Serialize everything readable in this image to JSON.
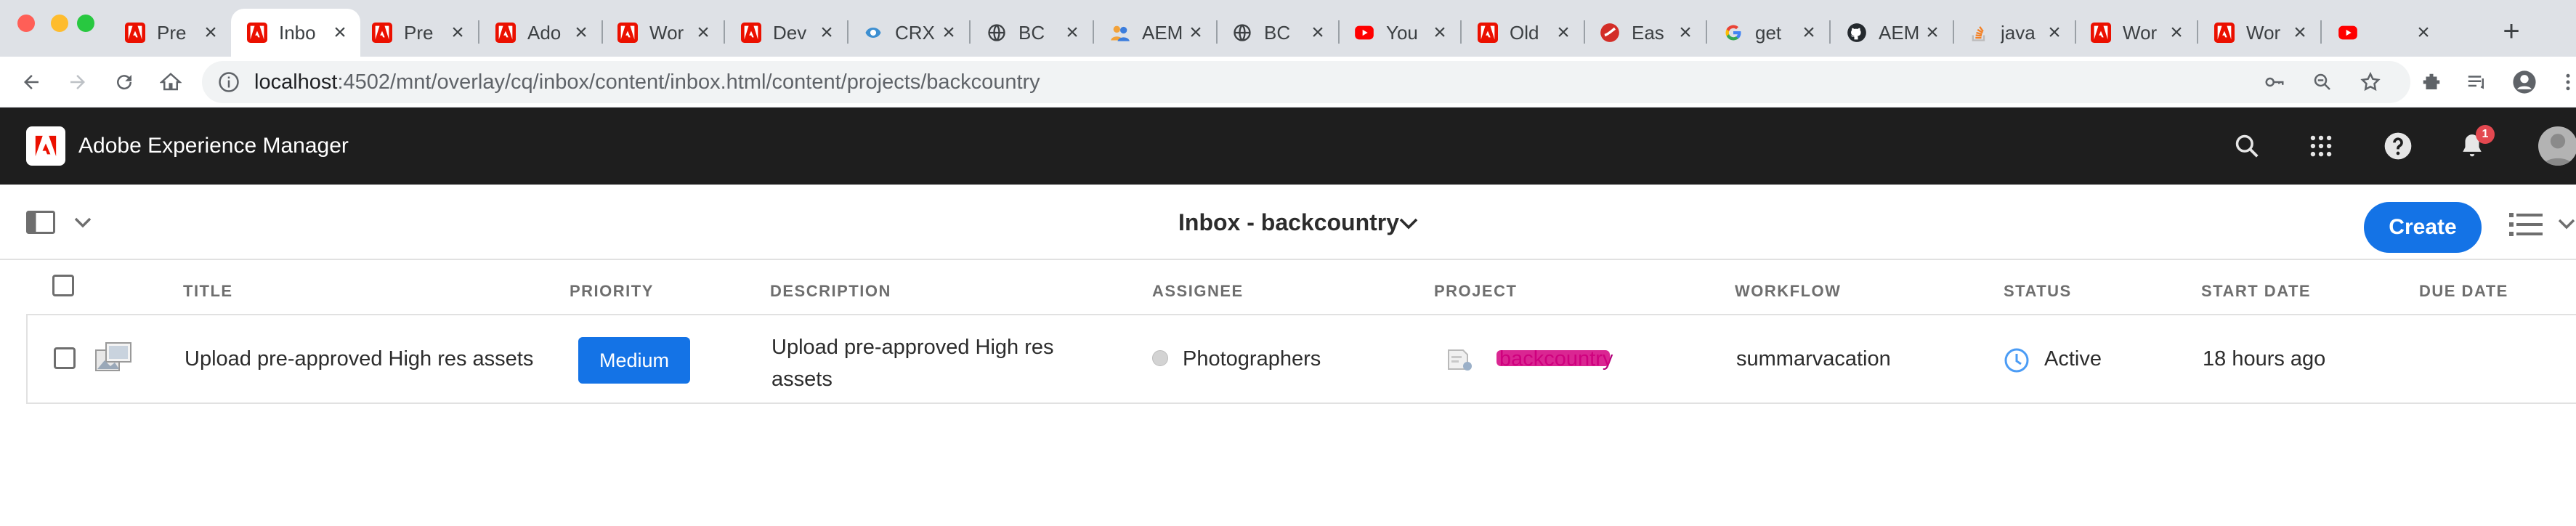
{
  "browser": {
    "tabs": [
      {
        "label": "Pre",
        "icon": "adobe-icon",
        "active": false
      },
      {
        "label": "Inbo",
        "icon": "adobe-icon",
        "active": true
      },
      {
        "label": "Pre",
        "icon": "adobe-icon",
        "active": false
      },
      {
        "label": "Ado",
        "icon": "adobe-icon",
        "active": false
      },
      {
        "label": "Wor",
        "icon": "adobe-icon",
        "active": false
      },
      {
        "label": "Dev",
        "icon": "adobe-icon",
        "active": false
      },
      {
        "label": "CRX",
        "icon": "crx-icon",
        "active": false
      },
      {
        "label": "BC",
        "icon": "globe-icon",
        "active": false
      },
      {
        "label": "AEM",
        "icon": "people-icon",
        "active": false
      },
      {
        "label": "BC",
        "icon": "globe-icon",
        "active": false
      },
      {
        "label": "You",
        "icon": "youtube-icon",
        "active": false
      },
      {
        "label": "Old",
        "icon": "adobe-icon",
        "active": false
      },
      {
        "label": "Eas",
        "icon": "lastpass-icon",
        "active": false
      },
      {
        "label": "get",
        "icon": "google-icon",
        "active": false
      },
      {
        "label": "AEM",
        "icon": "github-icon",
        "active": false
      },
      {
        "label": "java",
        "icon": "stackoverflow-icon",
        "active": false
      },
      {
        "label": "Wor",
        "icon": "adobe-icon",
        "active": false
      },
      {
        "label": "Wor",
        "icon": "adobe-icon",
        "active": false
      },
      {
        "label": "",
        "icon": "youtube-audio-icon",
        "active": false
      }
    ],
    "url_host": "localhost",
    "url_rest": ":4502/mnt/overlay/cq/inbox/content/inbox.html/content/projects/backcountry",
    "notification_count": "1"
  },
  "app": {
    "title": "Adobe Experience Manager",
    "page_title": "Inbox - backcountry",
    "create_label": "Create"
  },
  "table": {
    "headers": {
      "title": "TITLE",
      "priority": "PRIORITY",
      "description": "DESCRIPTION",
      "assignee": "ASSIGNEE",
      "project": "PROJECT",
      "workflow": "WORKFLOW",
      "status": "STATUS",
      "start_date": "START DATE",
      "due_date": "DUE DATE"
    },
    "rows": [
      {
        "title": "Upload pre-approved High res assets",
        "priority": "Medium",
        "description": "Upload pre-approved High res assets",
        "assignee": "Photographers",
        "project": "backcountry",
        "workflow": "summarvacation",
        "status": "Active",
        "start_date": "18 hours ago",
        "due_date": ""
      }
    ]
  },
  "colors": {
    "accent": "#1473e6",
    "header_bg": "#1e1e1e",
    "redaction": "#d4007f"
  }
}
